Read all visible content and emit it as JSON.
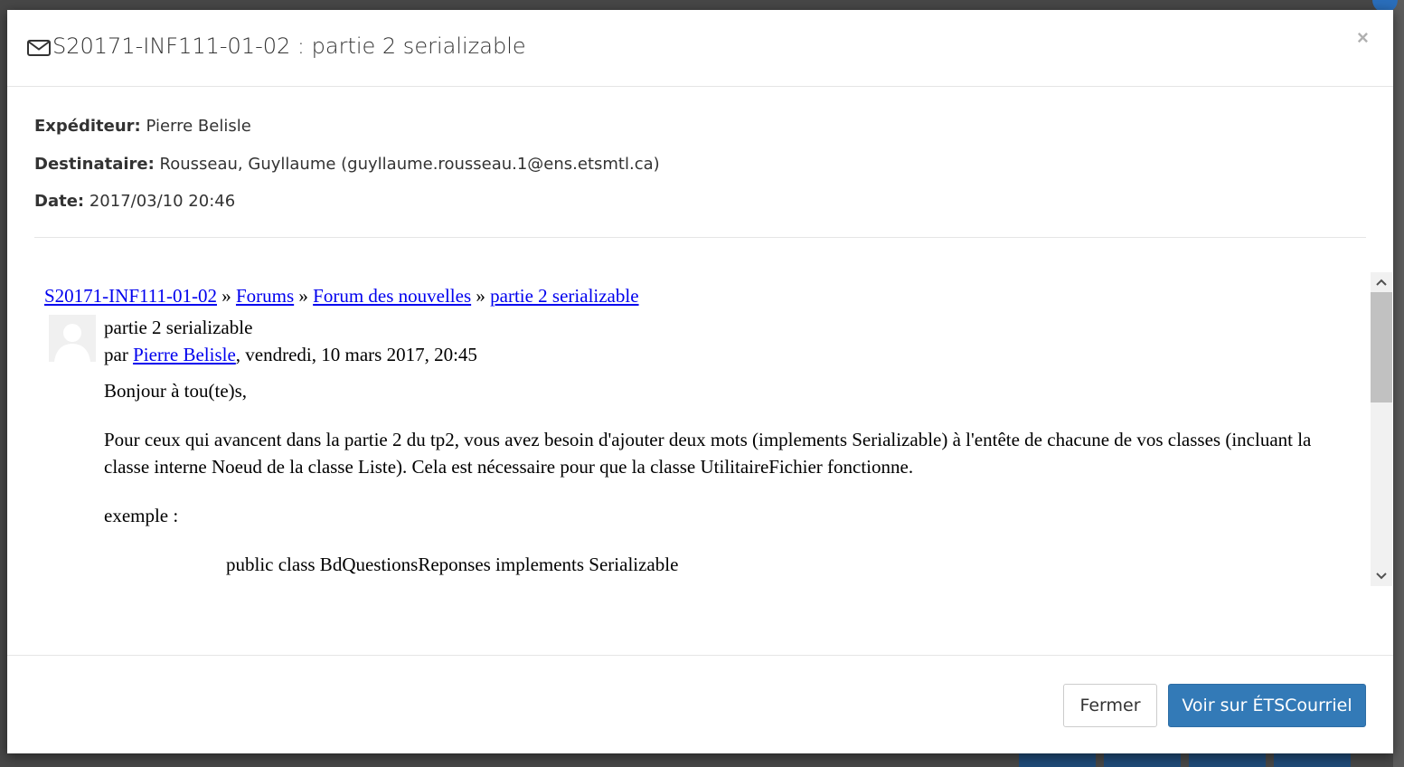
{
  "modal": {
    "title": "S20171-INF111-01-02 : partie 2 serializable",
    "close_glyph": "×",
    "title_icon": "envelope-icon"
  },
  "meta": {
    "sender_label": "Expéditeur:",
    "sender_value": "Pierre Belisle",
    "recipient_label": "Destinataire:",
    "recipient_value": "Rousseau, Guyllaume (guyllaume.rousseau.1@ens.etsmtl.ca)",
    "date_label": "Date:",
    "date_value": "2017/03/10 20:46"
  },
  "message": {
    "breadcrumb": {
      "course": "S20171-INF111-01-02",
      "sep": " » ",
      "forums": "Forums",
      "forum": "Forum des nouvelles",
      "thread": "partie 2 serializable"
    },
    "subject": "partie 2 serializable",
    "author_prefix": "par ",
    "author": "Pierre Belisle",
    "author_suffix": ", vendredi, 10 mars 2017, 20:45",
    "paragraphs": {
      "greeting": "Bonjour à tou(te)s,",
      "body": "Pour ceux qui avancent dans la partie 2 du tp2, vous avez besoin d'ajouter deux mots (implements Serializable) à l'entête de chacune de vos classes (incluant la classe interne Noeud de la classe Liste).  Cela est nécessaire pour que la classe UtilitaireFichier fonctionne.",
      "example_label": "exemple :",
      "code": "public class BdQuestionsReponses implements Serializable"
    }
  },
  "scrollbar": {
    "up_glyph": "⌃",
    "down_glyph": "⌄"
  },
  "footer": {
    "close_label": "Fermer",
    "open_label": "Voir sur ÉTSCourriel"
  },
  "colors": {
    "primary": "#337ab7",
    "link": "#0000ee"
  }
}
